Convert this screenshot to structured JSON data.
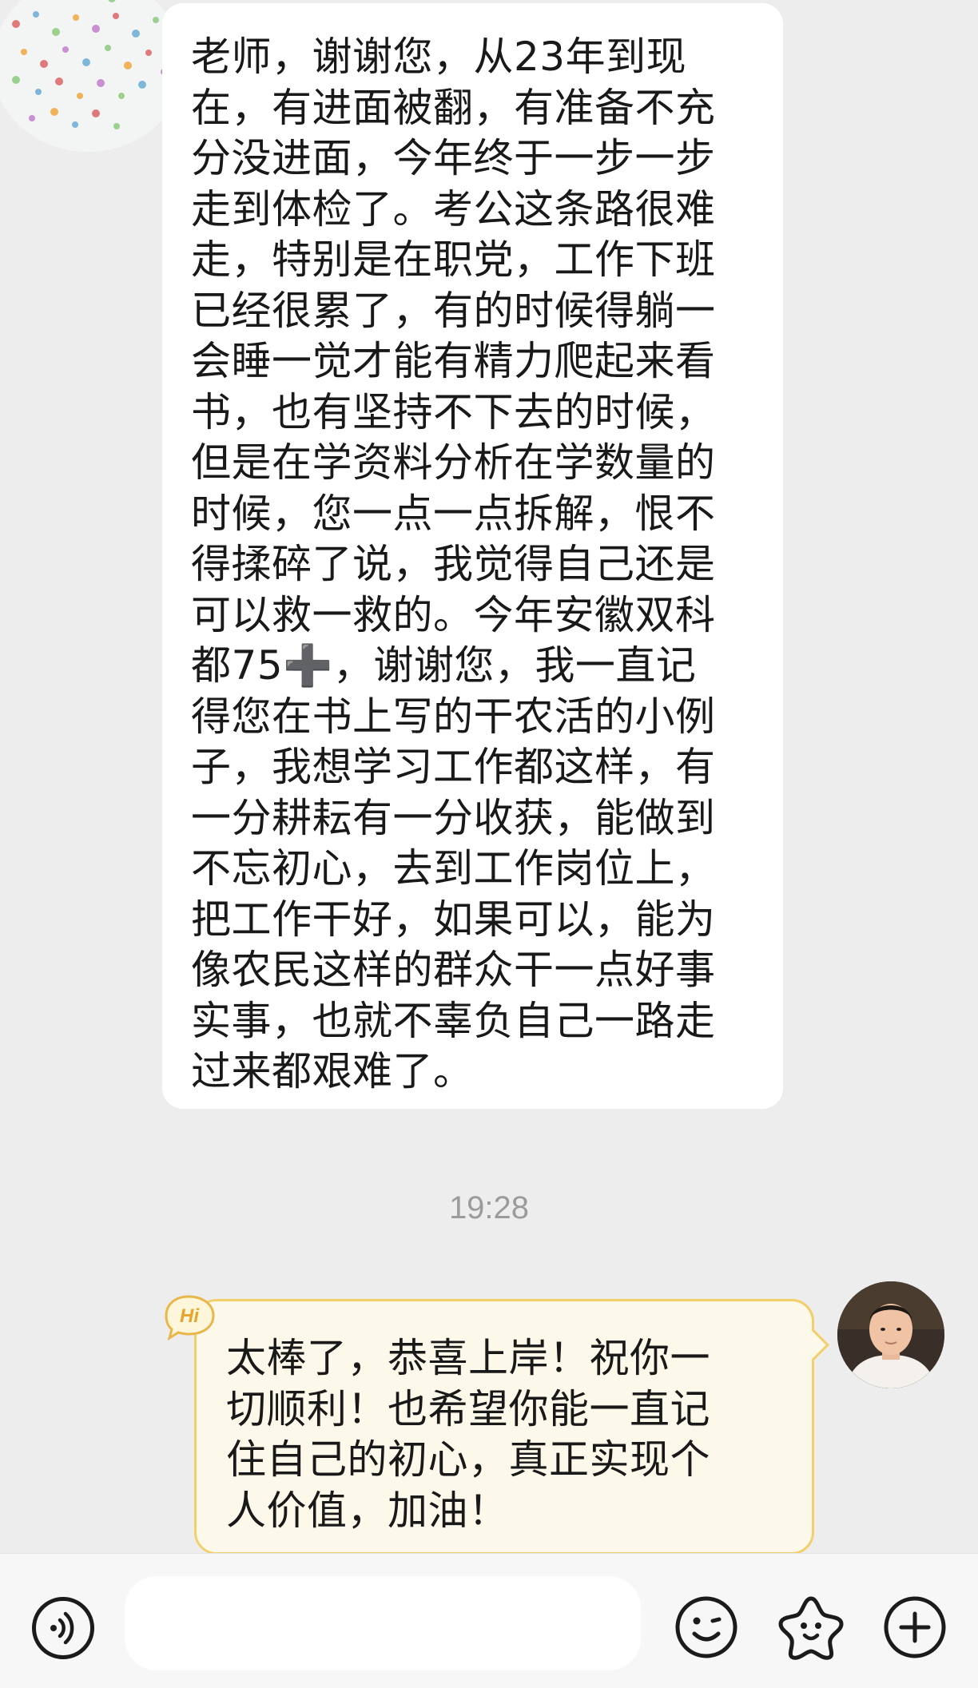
{
  "chat": {
    "incoming": {
      "text": "老师，谢谢您，从23年到现\n在，有进面被翻，有准备不充\n分没进面，今年终于一步一步\n走到体检了。考公这条路很难\n走，特别是在职党，工作下班\n已经很累了，有的时候得躺一\n会睡一觉才能有精力爬起来看\n书，也有坚持不下去的时候，\n但是在学资料分析在学数量的\n时候，您一点一点拆解，恨不\n得揉碎了说，我觉得自己还是\n可以救一救的。今年安徽双科\n都75➕，谢谢您，我一直记\n得您在书上写的干农活的小例\n子，我想学习工作都这样，有\n一分耕耘有一分收获，能做到\n不忘初心，去到工作岗位上，\n把工作干好，如果可以，能为\n像农民这样的群众干一点好事\n实事，也就不辜负自己一路走\n过来都艰难了。"
    },
    "timestamp": "19:28",
    "outgoing": {
      "badge": "Hi",
      "text": "太棒了，恭喜上岸！祝你一\n切顺利！也希望你能一直记\n住自己的初心，真正实现个\n人价值，加油！"
    }
  },
  "input_bar": {
    "input_value": "",
    "icons": [
      "voice-icon",
      "emoji-icon",
      "sticker-icon",
      "plus-icon"
    ]
  },
  "colors": {
    "background": "#ededed",
    "incoming_bubble": "#ffffff",
    "outgoing_bubble": "#fdf9ea",
    "outgoing_border": "#f3cf6a",
    "timestamp": "#9b9b9b"
  }
}
